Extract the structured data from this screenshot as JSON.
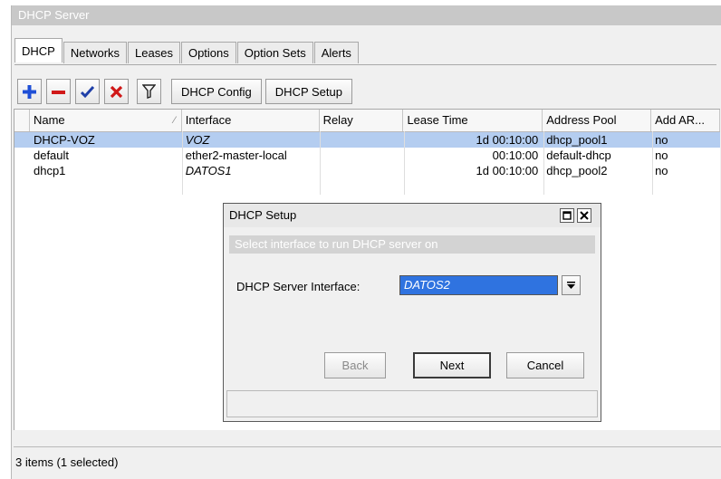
{
  "window": {
    "title": "DHCP Server"
  },
  "tabs": [
    {
      "label": "DHCP",
      "active": true
    },
    {
      "label": "Networks"
    },
    {
      "label": "Leases"
    },
    {
      "label": "Options"
    },
    {
      "label": "Option Sets"
    },
    {
      "label": "Alerts"
    }
  ],
  "toolbar": {
    "add_icon": "plus-icon",
    "remove_icon": "minus-icon",
    "enable_icon": "check-icon",
    "disable_icon": "cross-icon",
    "filter_icon": "filter-icon",
    "dhcp_config_label": "DHCP Config",
    "dhcp_setup_label": "DHCP Setup",
    "colors": {
      "add": "#1f4fd6",
      "remove": "#d01818",
      "enable": "#1f3fa8",
      "disable": "#d01818"
    }
  },
  "table": {
    "columns": [
      "Name",
      "Interface",
      "Relay",
      "Lease Time",
      "Address Pool",
      "Add AR..."
    ],
    "rows": [
      {
        "name": "DHCP-VOZ",
        "interface": "VOZ",
        "relay": "",
        "lease_time": "1d 00:10:00",
        "address_pool": "dhcp_pool1",
        "add_arp": "no",
        "selected": true
      },
      {
        "name": "default",
        "interface": "ether2-master-local",
        "relay": "",
        "lease_time": "00:10:00",
        "address_pool": "default-dhcp",
        "add_arp": "no"
      },
      {
        "name": "dhcp1",
        "interface": "DATOS1",
        "relay": "",
        "lease_time": "1d 00:10:00",
        "address_pool": "dhcp_pool2",
        "add_arp": "no"
      }
    ]
  },
  "status": {
    "text": "3 items (1 selected)"
  },
  "dialog": {
    "title": "DHCP Setup",
    "banner": "Select interface to run DHCP server on",
    "field_label": "DHCP Server Interface:",
    "field_value": "DATOS2",
    "back_label": "Back",
    "next_label": "Next",
    "cancel_label": "Cancel"
  },
  "colors": {
    "selection": "#b4cdf0",
    "input_highlight": "#2f73e0",
    "titlebar": "#c8c8c8"
  }
}
